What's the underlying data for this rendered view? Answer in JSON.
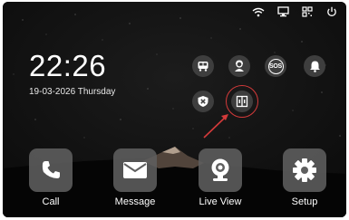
{
  "status_bar": {
    "icons": [
      "wifi-icon",
      "monitor-icon",
      "qr-code-icon",
      "power-icon"
    ]
  },
  "clock": {
    "time": "22:26",
    "date": "19-03-2026 Thursday"
  },
  "quick_actions": [
    {
      "icon": "elevator-icon"
    },
    {
      "icon": "concierge-icon"
    },
    {
      "icon": "sos-icon",
      "label": "SOS"
    },
    {
      "icon": "bell-icon"
    },
    {
      "icon": "disarm-shield-icon"
    },
    {
      "icon": "door-unlock-icon",
      "highlighted": true
    }
  ],
  "dock": [
    {
      "label": "Call",
      "icon": "phone-icon"
    },
    {
      "label": "Message",
      "icon": "envelope-icon"
    },
    {
      "label": "Live View",
      "icon": "camera-icon"
    },
    {
      "label": "Setup",
      "icon": "gear-icon"
    }
  ],
  "colors": {
    "background": "#101010",
    "tile": "#5f5f5f",
    "quick_button": "#3e3e3e",
    "highlight": "#d33a3a",
    "text": "#ffffff"
  }
}
